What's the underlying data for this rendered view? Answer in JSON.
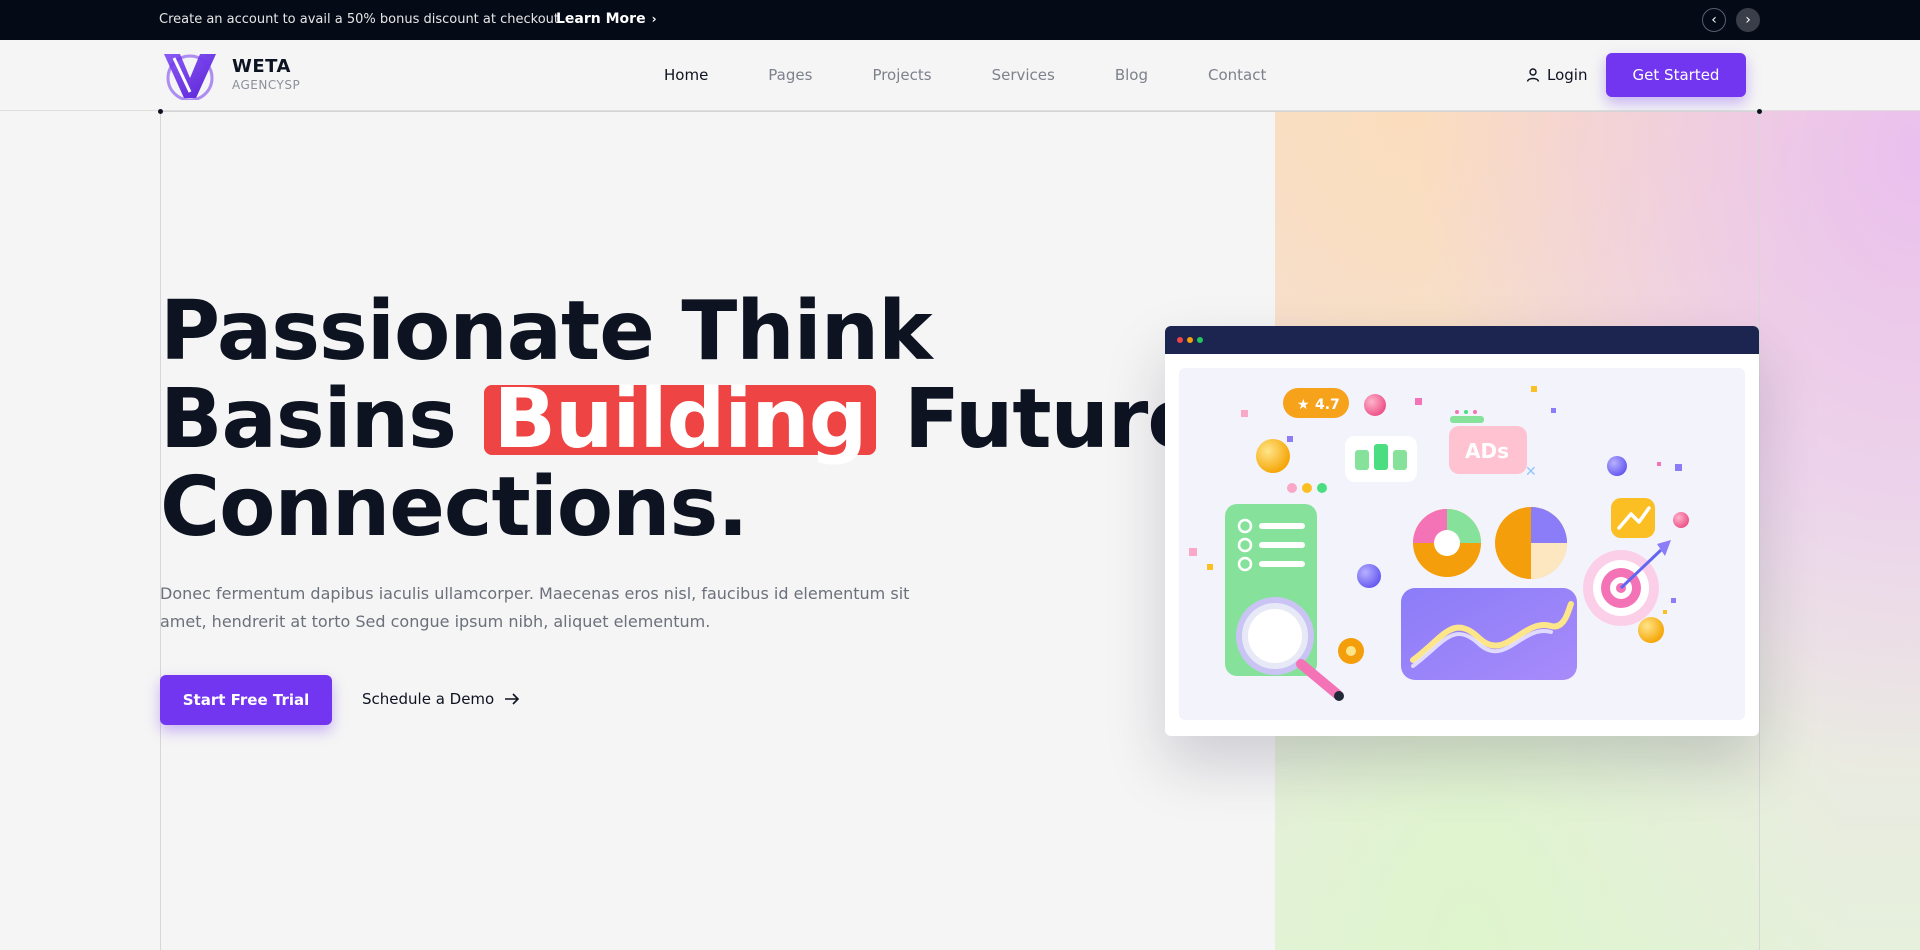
{
  "topbar": {
    "message": "Create an account to avail a 50% bonus discount at checkout.",
    "link_label": "Learn More",
    "prev_icon": "chevron-left-icon",
    "next_icon": "chevron-right-icon"
  },
  "header": {
    "logo": {
      "name": "WETA",
      "tagline": "AGENCYSP"
    },
    "nav": [
      {
        "label": "Home",
        "active": true
      },
      {
        "label": "Pages",
        "active": false
      },
      {
        "label": "Projects",
        "active": false
      },
      {
        "label": "Services",
        "active": false
      },
      {
        "label": "Blog",
        "active": false
      },
      {
        "label": "Contact",
        "active": false
      }
    ],
    "login_label": "Login",
    "cta_label": "Get Started"
  },
  "hero": {
    "headline": {
      "line1": "Passionate Think",
      "line2_before": "Basins",
      "line2_highlight": "Building",
      "line2_after": "Future",
      "line3": "Connections."
    },
    "description": "Donec fermentum dapibus iaculis ullamcorper. Maecenas eros nisl, faucibus id elementum sit amet, hendrerit at torto Sed congue ipsum nibh, aliquet elementum.",
    "primary_button": "Start Free Trial",
    "secondary_button": "Schedule a Demo"
  },
  "illustration": {
    "rating": "4.7",
    "ads_label": "ADs"
  },
  "colors": {
    "accent": "#7236f0",
    "highlight": "#ef4444",
    "dark": "#050a17",
    "mock_bar": "#1b2550"
  }
}
